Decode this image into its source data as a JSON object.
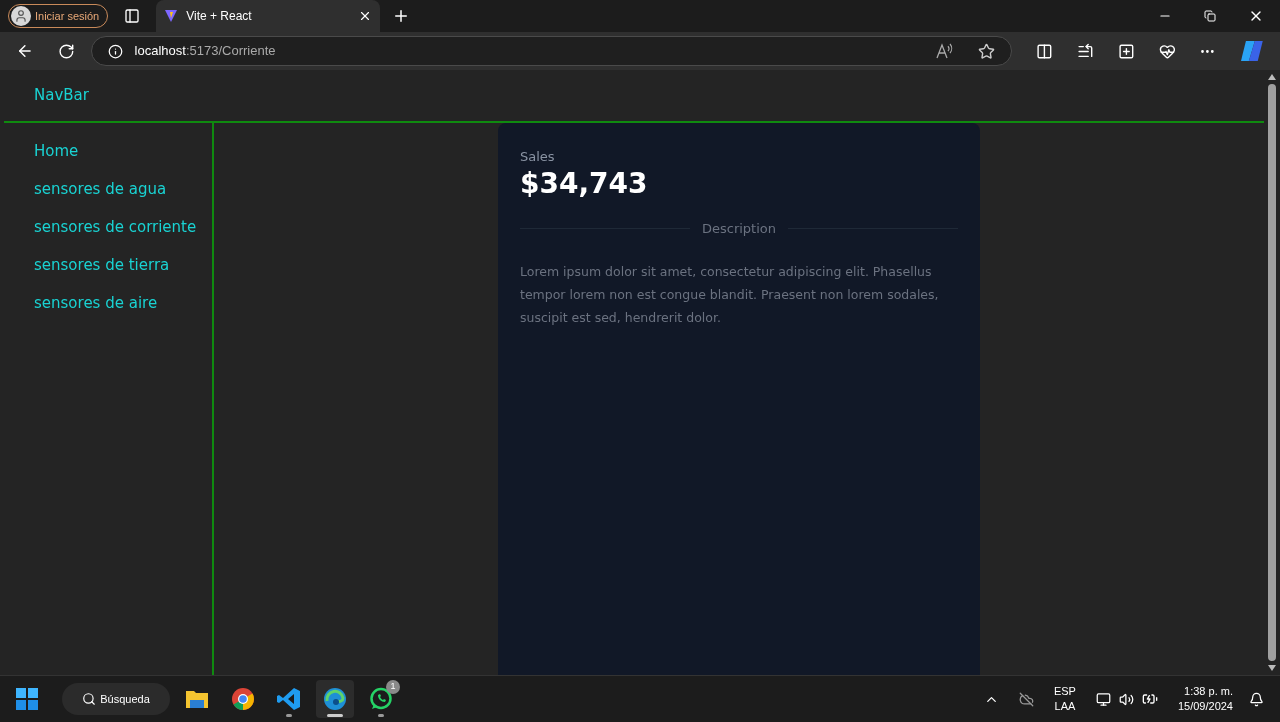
{
  "browser": {
    "profile": "Iniciar sesión",
    "tab": {
      "title": "Vite + React"
    },
    "url": {
      "host": "localhost",
      "path": ":5173/Corriente"
    }
  },
  "navbar": {
    "title": "NavBar"
  },
  "sidebar": {
    "items": [
      {
        "label": "Home"
      },
      {
        "label": "sensores de agua"
      },
      {
        "label": "sensores de corriente"
      },
      {
        "label": "sensores de tierra"
      },
      {
        "label": "sensores de aire"
      }
    ]
  },
  "card": {
    "label": "Sales",
    "value": "$34,743",
    "divider": "Description",
    "body": "Lorem ipsum dolor sit amet, consectetur adipiscing elit. Phasellus tempor lorem non est congue blandit. Praesent non lorem sodales, suscipit est sed, hendrerit dolor."
  },
  "taskbar": {
    "search": "Búsqueda",
    "apps": [
      {
        "kind": "folder",
        "running": false,
        "selected": false
      },
      {
        "kind": "chrome",
        "running": false,
        "selected": false
      },
      {
        "kind": "code",
        "running": true,
        "selected": false
      },
      {
        "kind": "edge",
        "running": true,
        "selected": true
      },
      {
        "kind": "whatsapp",
        "running": true,
        "selected": false,
        "badge": "1"
      }
    ],
    "lang": "ESP",
    "layout": "LAA",
    "time": "1:38 p. m.",
    "date": "15/09/2024"
  }
}
